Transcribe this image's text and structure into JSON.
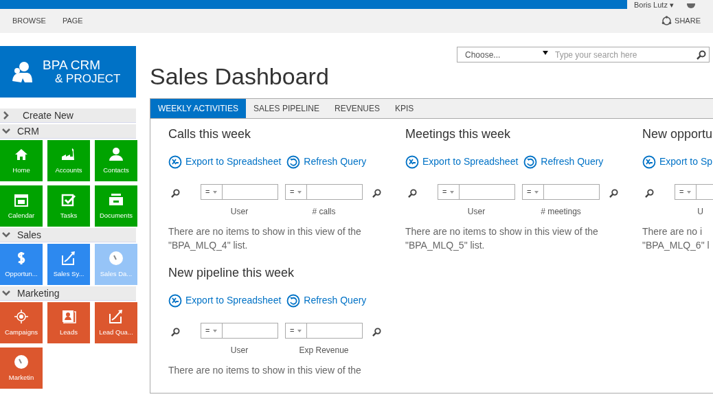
{
  "suite_bar": {
    "user": "Boris Lutz ▾"
  },
  "ribbon": {
    "tabs": [
      {
        "label": "BROWSE"
      },
      {
        "label": "PAGE"
      }
    ],
    "share": "SHARE"
  },
  "logo": {
    "line1": "BPA CRM",
    "line2": "& PROJECT"
  },
  "search": {
    "scope": "Choose...",
    "placeholder": "Type your search here"
  },
  "page_title": "Sales Dashboard",
  "sidebar": [
    {
      "label": "Create New",
      "expanded": false
    },
    {
      "label": "CRM",
      "expanded": true,
      "tiles": [
        {
          "label": "Home",
          "selected": false
        },
        {
          "label": "Accounts",
          "selected": false
        },
        {
          "label": "Contacts",
          "selected": false
        },
        {
          "label": "Calendar",
          "selected": false
        },
        {
          "label": "Tasks",
          "selected": false
        },
        {
          "label": "Documents",
          "selected": false
        }
      ]
    },
    {
      "label": "Sales",
      "expanded": true,
      "tiles": [
        {
          "label": "Opportun...",
          "selected": false
        },
        {
          "label": "Sales Sy...",
          "selected": false
        },
        {
          "label": "Sales Da...",
          "selected": true
        }
      ]
    },
    {
      "label": "Marketing",
      "expanded": true,
      "tiles": [
        {
          "label": "Campaigns",
          "selected": false
        },
        {
          "label": "Leads",
          "selected": false
        },
        {
          "label": "Lead Qua...",
          "selected": false
        },
        {
          "label": "Marketin",
          "selected": false
        }
      ]
    }
  ],
  "tabs": [
    {
      "label": "WEEKLY ACTIVITIES",
      "selected": true
    },
    {
      "label": "SALES PIPELINE",
      "selected": false
    },
    {
      "label": "REVENUES",
      "selected": false
    },
    {
      "label": "KPIS",
      "selected": false
    }
  ],
  "webparts": [
    {
      "title": "Calls this week",
      "actions": [
        {
          "kind": "export",
          "label": "Export to Spreadsheet"
        },
        {
          "kind": "refresh",
          "label": "Refresh Query"
        }
      ],
      "filters": [
        {
          "operator": "=",
          "label": "User"
        },
        {
          "operator": "=",
          "label": "# calls"
        }
      ],
      "message": "There are no items to show in this view of the \"BPA_MLQ_4\" list."
    },
    {
      "title": "Meetings this week",
      "actions": [
        {
          "kind": "export",
          "label": "Export to Spreadsheet"
        },
        {
          "kind": "refresh",
          "label": "Refresh Query"
        }
      ],
      "filters": [
        {
          "operator": "=",
          "label": "User"
        },
        {
          "operator": "=",
          "label": "# meetings"
        }
      ],
      "message": "There are no items to show in this view of the \"BPA_MLQ_5\" list."
    },
    {
      "title": "New opportu",
      "actions": [
        {
          "kind": "export",
          "label": "Export to Sp"
        }
      ],
      "filters": [
        {
          "operator": "=",
          "label": "U"
        }
      ],
      "message": "There are no i\n\"BPA_MLQ_6\" l"
    },
    {
      "title": "New pipeline this week",
      "actions": [
        {
          "kind": "export",
          "label": "Export to Spreadsheet"
        },
        {
          "kind": "refresh",
          "label": "Refresh Query"
        }
      ],
      "filters": [
        {
          "operator": "=",
          "label": "User"
        },
        {
          "operator": "=",
          "label": "Exp Revenue"
        }
      ],
      "message": "There are no items to show in this view of the"
    }
  ]
}
